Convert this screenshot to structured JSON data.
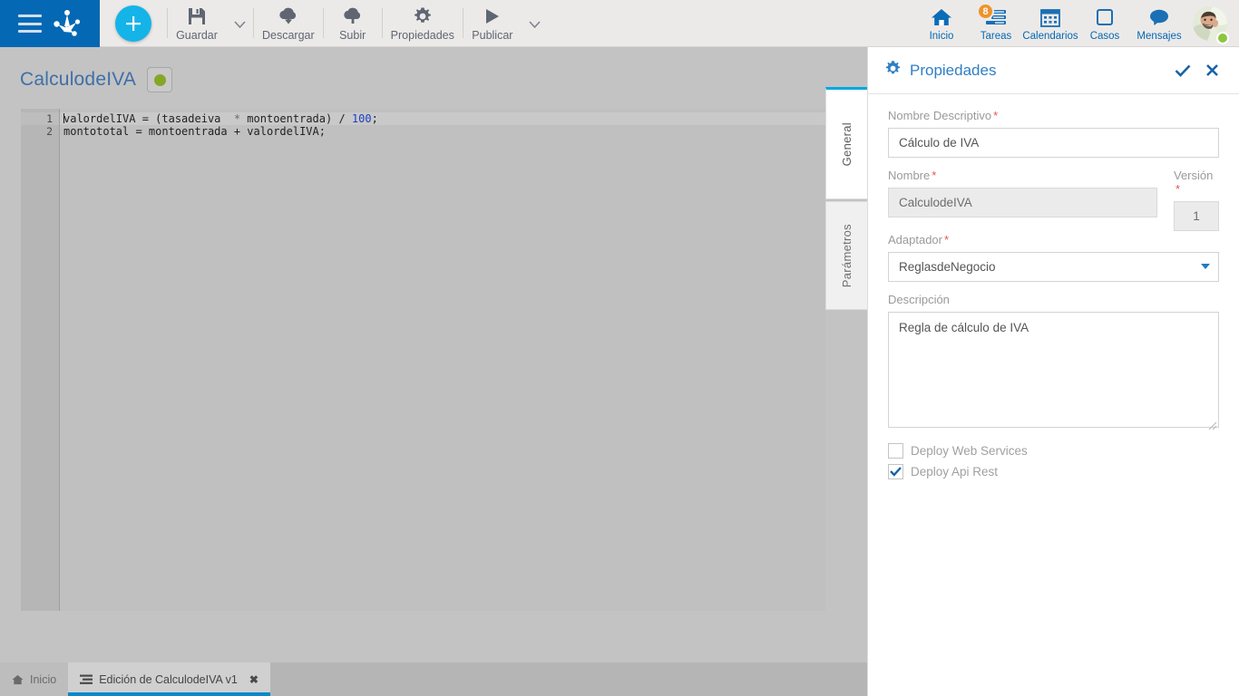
{
  "theme": {
    "brand_blue": "#0568b4",
    "accent_cyan": "#14b4e8",
    "nav_blue": "#0568b4",
    "badge_orange": "#f0922b",
    "required_red": "#e8534f",
    "status_green": "#84a728",
    "workspace_gray": "#c3c3c3"
  },
  "topbar": {
    "menu_icon": "hamburger-icon",
    "logo_icon": "app-logo-icon",
    "add_button_label": "+",
    "tools": [
      {
        "label": "Guardar",
        "icon": "save-floppy-icon",
        "has_caret": true
      },
      {
        "label": "Descargar",
        "icon": "cloud-download-icon",
        "has_caret": false
      },
      {
        "label": "Subir",
        "icon": "cloud-upload-icon",
        "has_caret": false
      },
      {
        "label": "Propiedades",
        "icon": "gear-icon",
        "has_caret": false
      },
      {
        "label": "Publicar",
        "icon": "play-icon",
        "has_caret": true
      }
    ],
    "nav": [
      {
        "label": "Inicio",
        "icon": "home-icon",
        "badge": ""
      },
      {
        "label": "Tareas",
        "icon": "tasks-icon",
        "badge": "8"
      },
      {
        "label": "Calendarios",
        "icon": "calendar-icon",
        "badge": ""
      },
      {
        "label": "Casos",
        "icon": "cases-square-icon",
        "badge": ""
      },
      {
        "label": "Mensajes",
        "icon": "chat-bubble-icon",
        "badge": ""
      }
    ],
    "avatar": {
      "name": "user-avatar",
      "status": "online"
    }
  },
  "workspace": {
    "document_title": "CalculodeIVA",
    "status_indicator": "green",
    "editor": {
      "lines": [
        {
          "number": "1",
          "active": true,
          "text": "valordelIVA = (tasadeiva  * montoentrada) / 100;"
        },
        {
          "number": "2",
          "active": false,
          "text": "montototal = montoentrada + valordelIVA;"
        }
      ]
    },
    "vertical_tabs": [
      {
        "label": "General",
        "active": true
      },
      {
        "label": "Parámetros",
        "active": false
      }
    ]
  },
  "panel": {
    "icon": "gear-icon",
    "title": "Propiedades",
    "confirm_icon": "check-icon",
    "close_icon": "close-icon",
    "fields": {
      "nombre_descriptivo": {
        "label": "Nombre Descriptivo",
        "required": "*",
        "value": "Cálculo de IVA",
        "placeholder": ""
      },
      "nombre": {
        "label": "Nombre",
        "required": "*",
        "value": "CalculodeIVA",
        "placeholder": ""
      },
      "version": {
        "label": "Versión",
        "required": "*",
        "value": "1",
        "placeholder": ""
      },
      "adaptador": {
        "label": "Adaptador",
        "required": "*",
        "value": "ReglasdeNegocio",
        "placeholder": "",
        "options": [
          "ReglasdeNegocio"
        ]
      },
      "descripcion": {
        "label": "Descripción",
        "required": "",
        "value": "Regla de cálculo de IVA",
        "placeholder": ""
      }
    },
    "checkboxes": [
      {
        "label": "Deploy Web Services",
        "checked": false
      },
      {
        "label": "Deploy Api Rest",
        "checked": true
      }
    ]
  },
  "taskbar": {
    "items": [
      {
        "label": "Inicio",
        "icon": "home-icon",
        "active": false,
        "closable": false
      },
      {
        "label": "Edición de CalculodeIVA v1",
        "icon": "document-lines-icon",
        "active": true,
        "closable": true,
        "close_glyph": "✖"
      }
    ]
  }
}
